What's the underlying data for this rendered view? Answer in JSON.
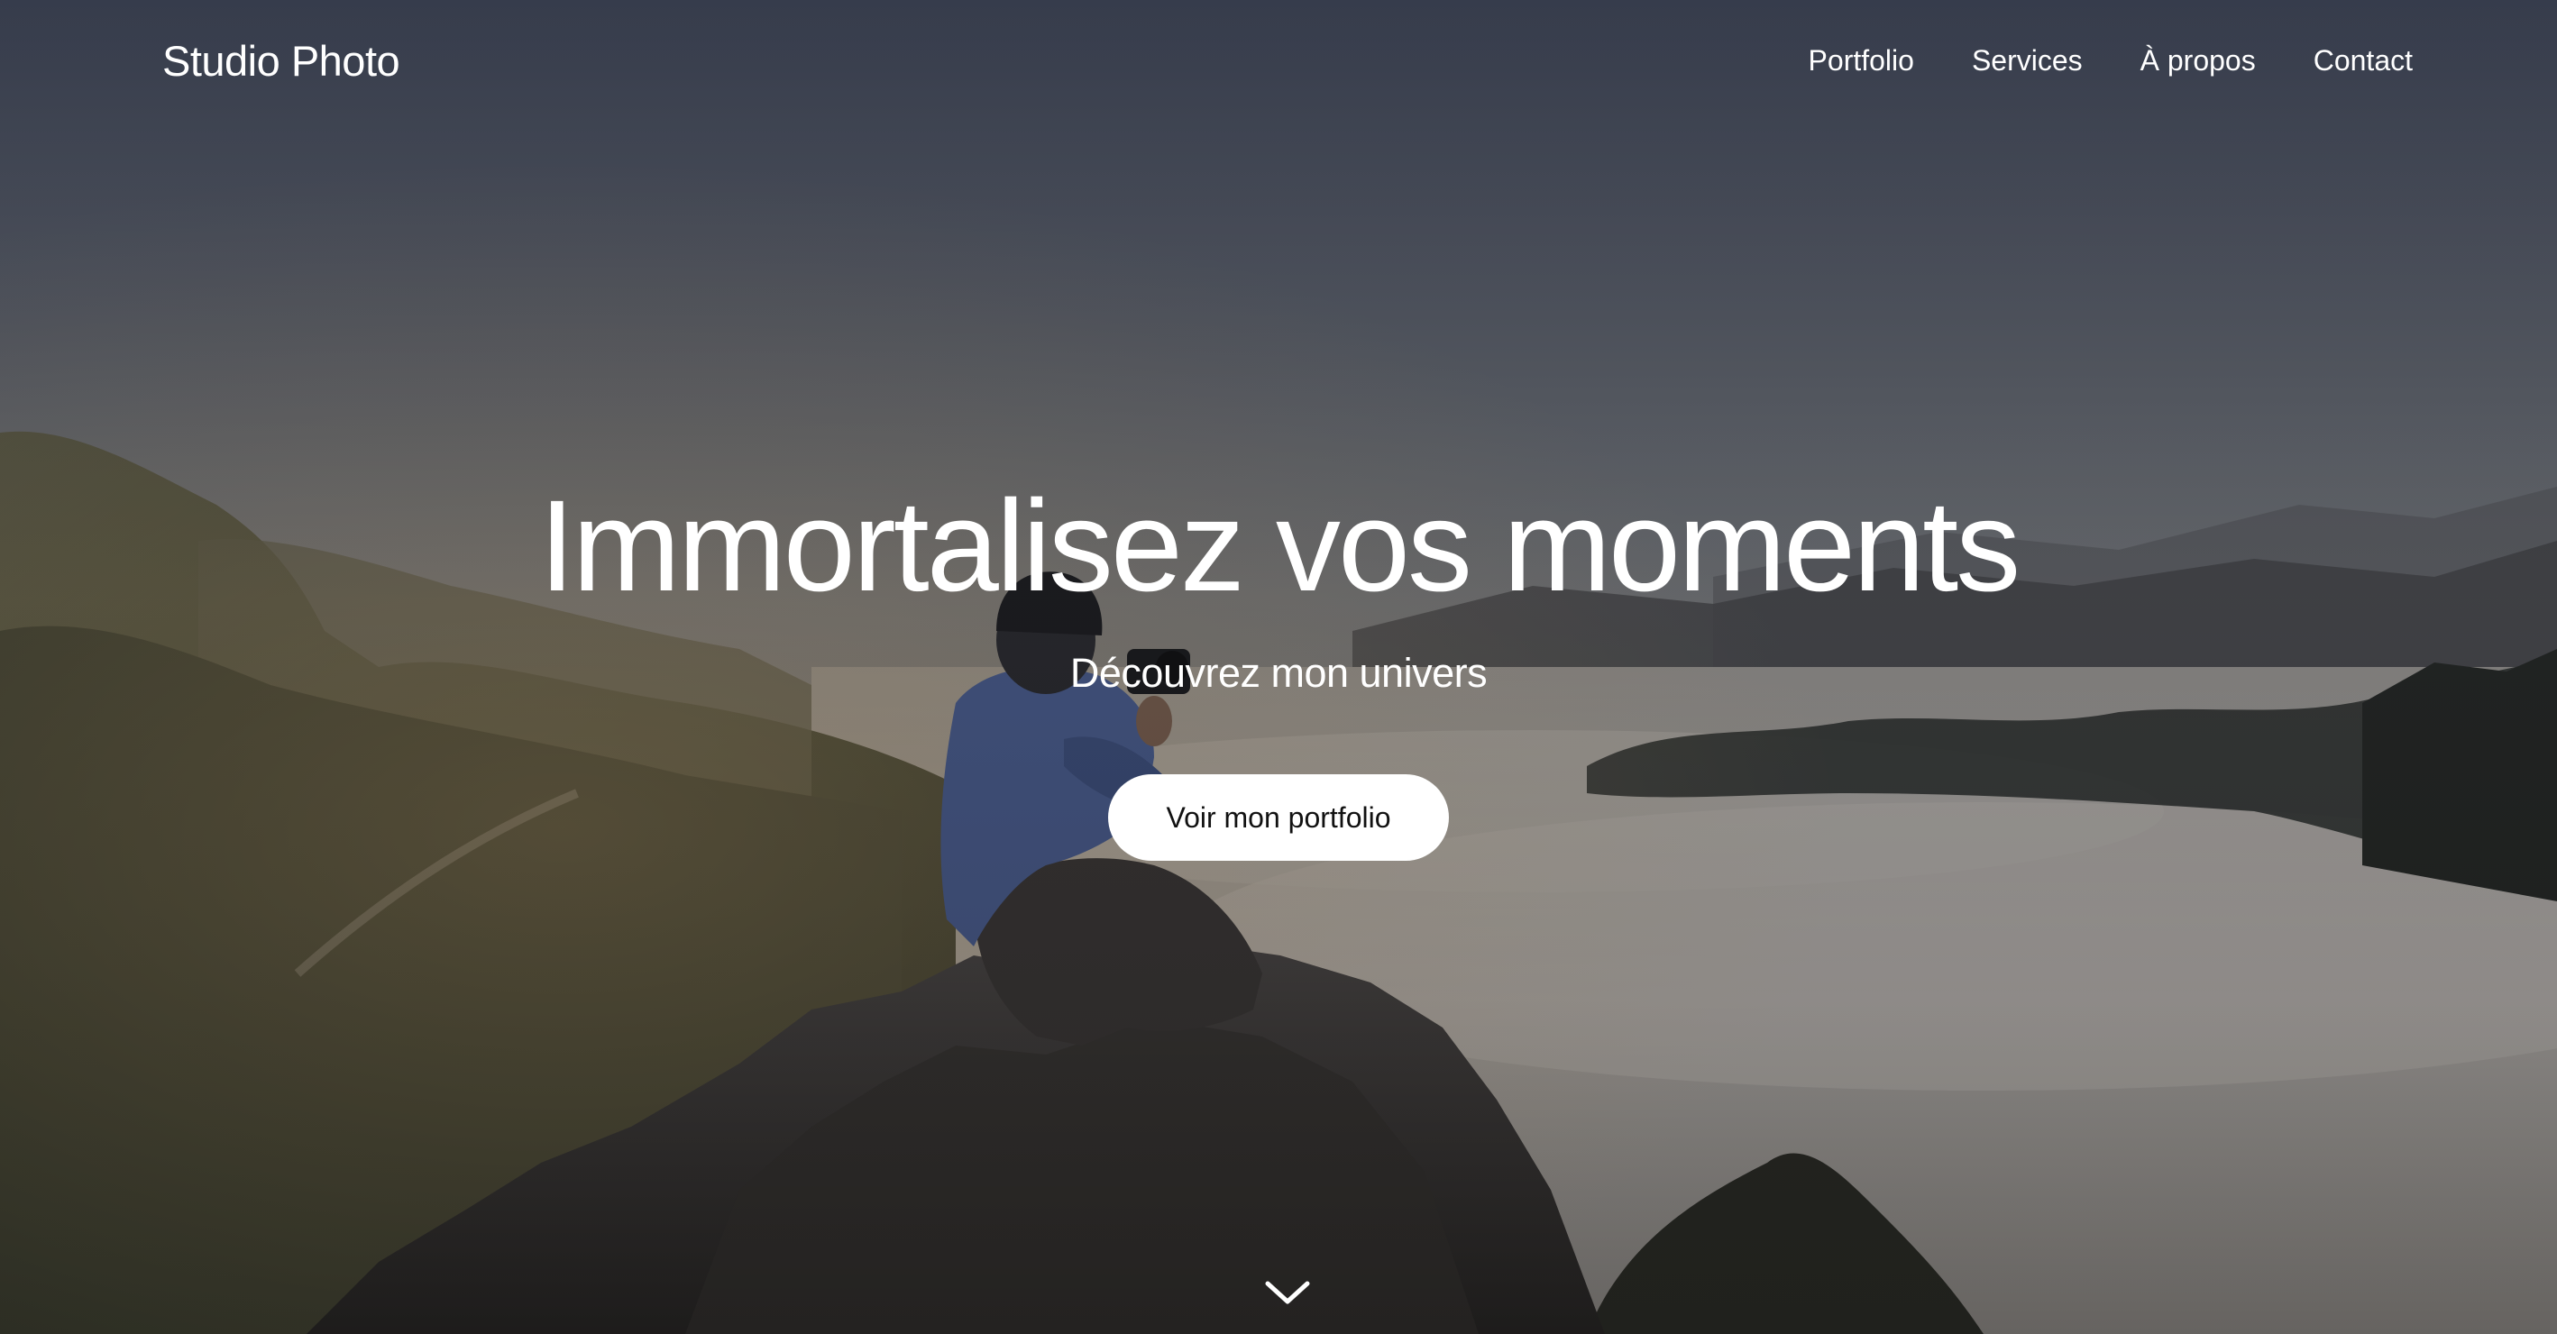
{
  "header": {
    "brand": "Studio Photo",
    "nav": [
      {
        "label": "Portfolio"
      },
      {
        "label": "Services"
      },
      {
        "label": "À propos"
      },
      {
        "label": "Contact"
      }
    ]
  },
  "hero": {
    "title": "Immortalisez vos moments",
    "subtitle": "Découvrez mon univers",
    "cta_label": "Voir mon portfolio",
    "background_alt": "photographer-on-mountain-peak-above-clouds"
  },
  "icons": {
    "scroll_down": "chevron-down-icon"
  },
  "colors": {
    "text": "#ffffff",
    "button_bg": "#ffffff",
    "button_text": "#111111",
    "sky_top": "#4b5264",
    "fog": "#a9a6a1"
  }
}
